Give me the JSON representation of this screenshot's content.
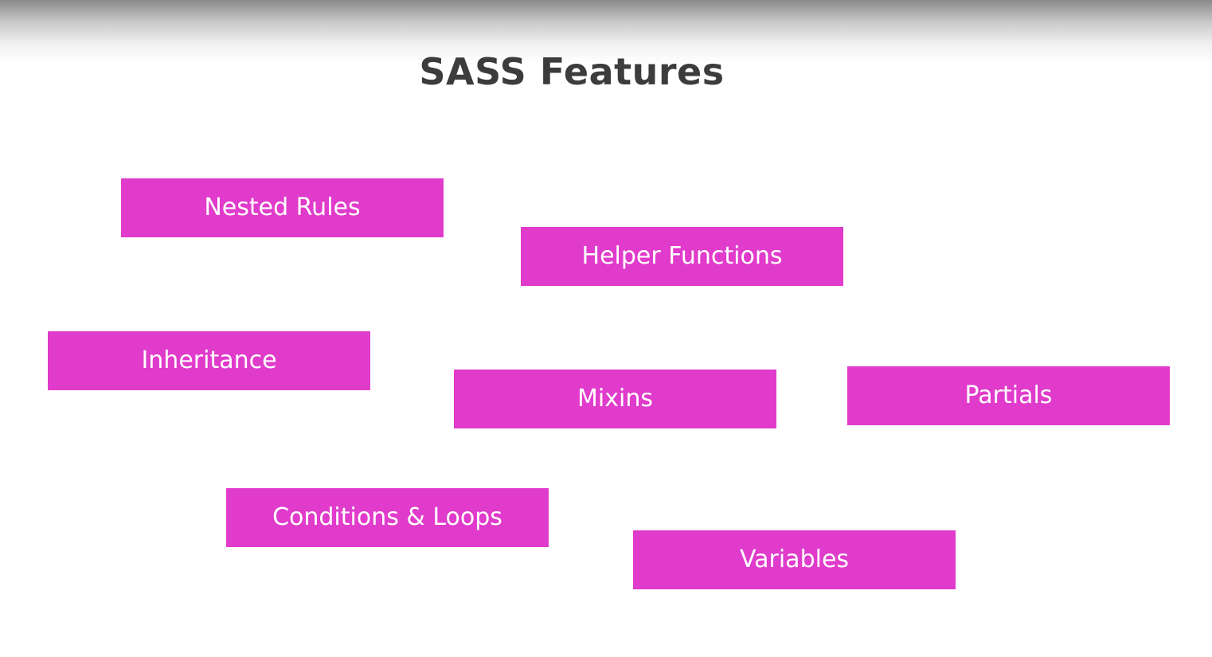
{
  "title": "SASS Features",
  "features": [
    "Nested Rules",
    "Helper Functions",
    "Inheritance",
    "Mixins",
    "Partials",
    "Conditions & Loops",
    "Variables"
  ],
  "colors": {
    "box_fill": "#e03bcb",
    "box_text": "#ffffff",
    "title_text": "#3c3c3c",
    "background": "#ffffff"
  }
}
